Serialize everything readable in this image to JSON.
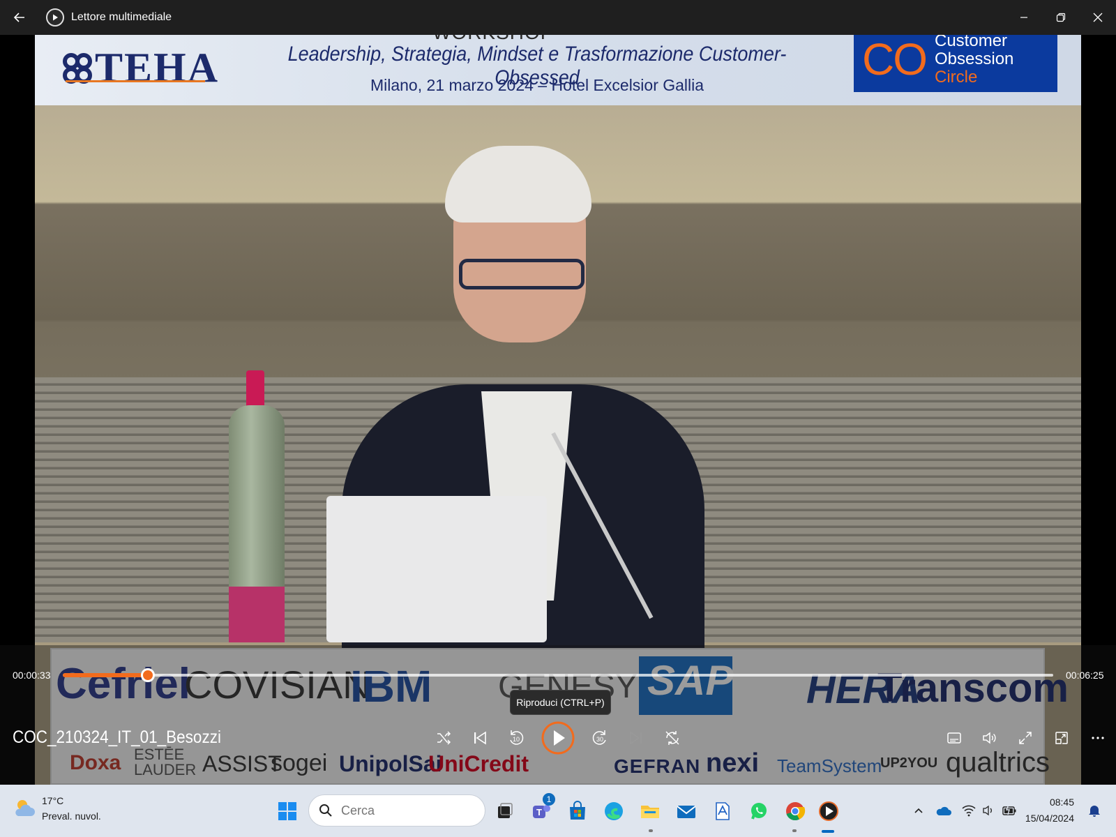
{
  "window": {
    "title": "Lettore multimediale"
  },
  "video": {
    "banner": {
      "logo_text": "TEHA",
      "workshop_label": "WORKSHOP",
      "title": "Leadership, Strategia, Mindset e Trasformazione Customer-Obsessed",
      "subtitle": "Milano, 21 marzo 2024 – Hotel Excelsior Gallia",
      "co_letters": "CO",
      "co_name_line1": "Customer Obsession",
      "co_name_line2": "Circle"
    },
    "sponsors_row1": [
      "Cefriel",
      "COVISIAN",
      "IBM",
      "GENESYS",
      "SAP",
      "HERA",
      "Transcom"
    ],
    "sponsors_row2": [
      "Doxa",
      "ESTĒE LAUDER",
      "ASSIST",
      "sogei",
      "UnipolSai",
      "UniCredit",
      "GEFRAN",
      "nexi",
      "TeamSystem",
      "UP2YOU",
      "qualtrics"
    ],
    "sponsor_colors": {
      "cefriel": "#2b3a8c",
      "covisian": "#333333",
      "ibm": "#1f4fa3",
      "sap": "#1b6fc5",
      "hera": "#1f3b80",
      "transcom": "#1c2a6b",
      "unicredit": "#d6001c",
      "nexi": "#1c2a6b",
      "qualtrics": "#333333"
    }
  },
  "player": {
    "current_time": "00:00:33",
    "total_time": "00:06:25",
    "progress_fraction": 0.0857,
    "file_name": "COC_210324_IT_01_Besozzi",
    "tooltip": "Riproduci (CTRL+P)",
    "accent_color": "#f26b1d"
  },
  "taskbar": {
    "weather_temp": "17°C",
    "weather_desc": "Preval. nuvol.",
    "search_placeholder": "Cerca",
    "teams_badge": "1",
    "time": "08:45",
    "date": "15/04/2024"
  }
}
